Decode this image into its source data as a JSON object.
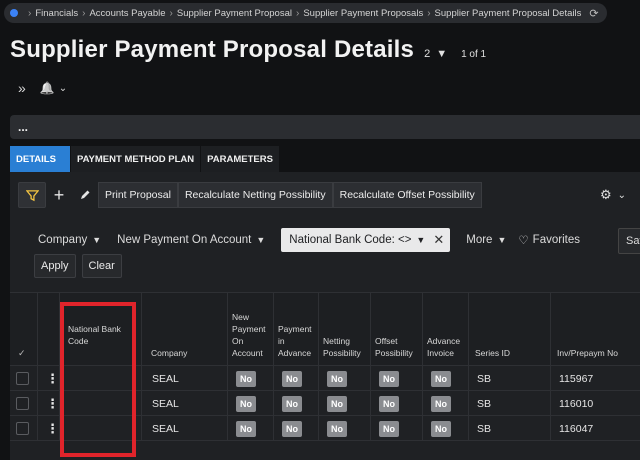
{
  "breadcrumb": {
    "items": [
      "Financials",
      "Accounts Payable",
      "Supplier Payment Proposal",
      "Supplier Payment Proposals",
      "Supplier Payment Proposal Details"
    ]
  },
  "header": {
    "title": "Supplier Payment Proposal Details",
    "record_count": "2",
    "record_of": "1 of 1"
  },
  "tools": {
    "collapse": "»",
    "bell": "🔔",
    "caret": "⌄"
  },
  "section_bar": {
    "label": "..."
  },
  "tabs": [
    {
      "label": "DETAILS",
      "active": true
    },
    {
      "label": "PAYMENT METHOD PLAN",
      "active": false
    },
    {
      "label": "PARAMETERS",
      "active": false
    }
  ],
  "toolbar": {
    "print": "Print Proposal",
    "recalc_netting": "Recalculate Netting Possibility",
    "recalc_offset": "Recalculate Offset Possibility",
    "gear": "⚙",
    "gear_caret": "⌄"
  },
  "search": {
    "company": "Company",
    "new_payment": "New Payment On Account",
    "chip": "National Bank Code: <>",
    "more": "More",
    "favorites": "Favorites",
    "save": "Save",
    "apply": "Apply",
    "clear": "Clear"
  },
  "grid": {
    "columns": [
      "National Bank Code",
      "Company",
      "New Payment On Account",
      "Payment in Advance",
      "Netting Possibility",
      "Offset Possibility",
      "Advance Invoice",
      "Series ID",
      "Inv/Prepaym No"
    ],
    "rows": [
      {
        "bank_code": "",
        "company": "SEAL",
        "new_pay": "No",
        "pay_adv": "No",
        "netting": "No",
        "offset": "No",
        "adv_inv": "No",
        "series": "SB",
        "inv_no": "115967"
      },
      {
        "bank_code": "",
        "company": "SEAL",
        "new_pay": "No",
        "pay_adv": "No",
        "netting": "No",
        "offset": "No",
        "adv_inv": "No",
        "series": "SB",
        "inv_no": "116010"
      },
      {
        "bank_code": "",
        "company": "SEAL",
        "new_pay": "No",
        "pay_adv": "No",
        "netting": "No",
        "offset": "No",
        "adv_inv": "No",
        "series": "SB",
        "inv_no": "116047"
      }
    ]
  },
  "colors": {
    "accent": "#2a7fd4",
    "highlight": "#e0242b",
    "badge": "#8a8c90"
  }
}
